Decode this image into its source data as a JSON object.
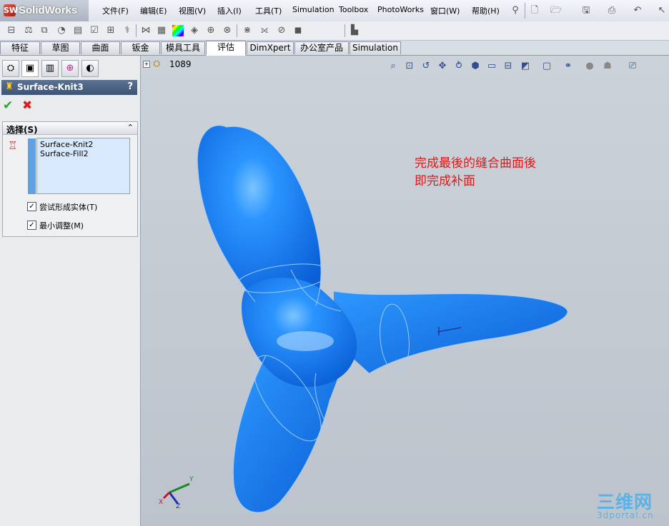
{
  "app": {
    "name": "SolidWorks",
    "logo_mark": "SW"
  },
  "menu": [
    "文件(F)",
    "编辑(E)",
    "视图(V)",
    "插入(I)",
    "工具(T)",
    "Simulation",
    "Toolbox",
    "PhotoWorks",
    "窗口(W)",
    "帮助(H)"
  ],
  "tabs": [
    "特征",
    "草图",
    "曲面",
    "钣金",
    "模具工具",
    "评估",
    "DimXpert",
    "办公室产品",
    "Simulation"
  ],
  "active_tab": "评估",
  "property_manager": {
    "title": "Surface-Knit3",
    "help": "?",
    "ok_icon": "check-icon",
    "cancel_icon": "close-icon",
    "group": {
      "title": "选择(S)",
      "items": [
        "Surface-Knit2",
        "Surface-Fill2"
      ],
      "options": [
        {
          "label": "尝试形成实体(T)",
          "checked": true
        },
        {
          "label": "最小调整(M)",
          "checked": true
        }
      ]
    }
  },
  "viewport": {
    "tree_node": "1089",
    "annotation": [
      "完成最後的缝合曲面後",
      "即完成补面"
    ],
    "model_color": "#1a7ef5",
    "triad": {
      "x": "X",
      "y": "Y",
      "z": "Z"
    },
    "origin_axes": {
      "x": "x",
      "y": "y"
    }
  },
  "watermark": {
    "big": "三维网",
    "small": "3dportal.cn"
  },
  "colors": {
    "annotation": "#e01818",
    "header": "#4a6084",
    "selection": "#d8e9fb",
    "watermark": "#5ab2e6"
  }
}
